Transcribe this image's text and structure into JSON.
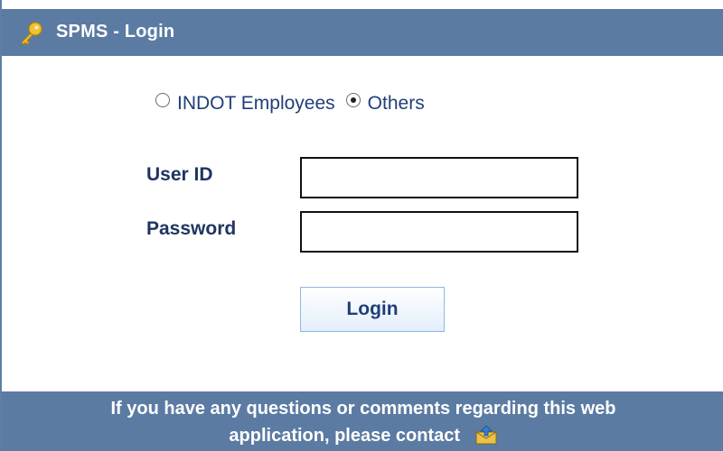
{
  "header": {
    "title": "SPMS - Login",
    "icon": "key-icon"
  },
  "user_type": {
    "options": [
      {
        "label": "INDOT Employees",
        "selected": false
      },
      {
        "label": "Others",
        "selected": true
      }
    ]
  },
  "form": {
    "user_id_label": "User ID",
    "user_id_value": "",
    "password_label": "Password",
    "password_value": "",
    "login_label": "Login"
  },
  "footer": {
    "line1": "If you have any questions or comments regarding this web",
    "line2": "application, please contact",
    "contact_icon": "contact-mail-icon"
  },
  "colors": {
    "header_bg": "#5b7ba3",
    "label_text": "#1f3560",
    "link_text": "#1f3f7a"
  }
}
